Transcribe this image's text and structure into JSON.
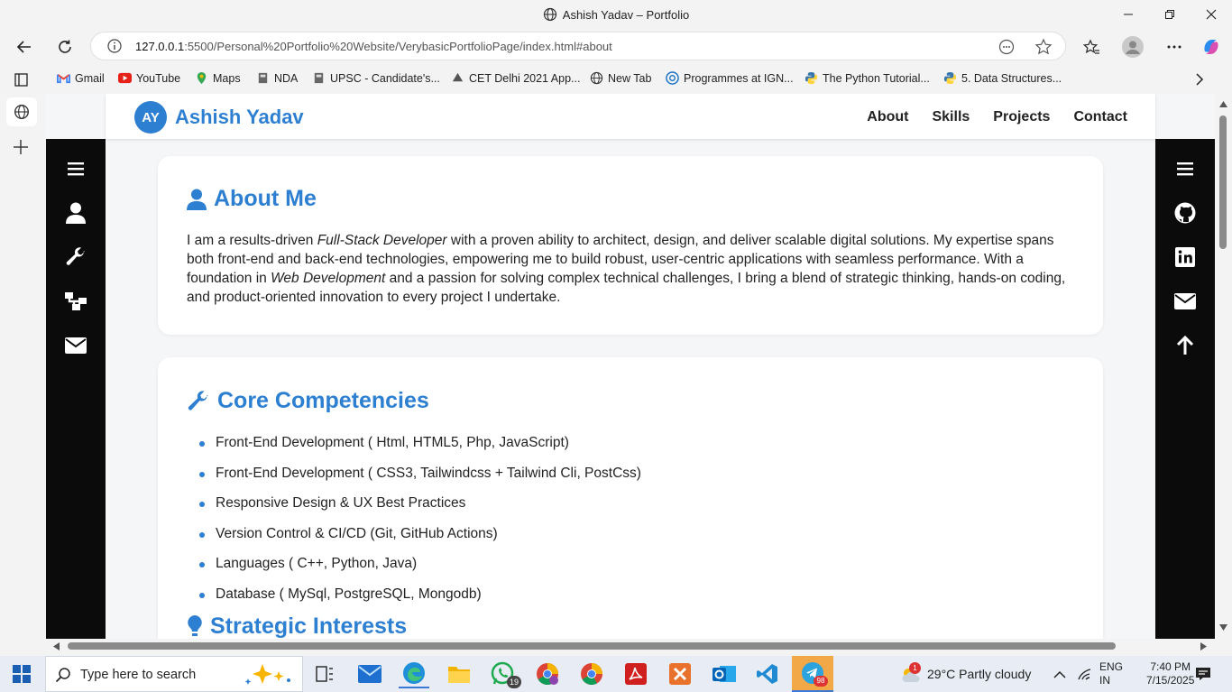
{
  "browser": {
    "window_title": "Ashish Yadav – Portfolio",
    "url_host": "127.0.0.1",
    "url_rest": ":5500/Personal%20Portfolio%20Website/VerybasicPortfolioPage/index.html#about",
    "bookmarks": [
      {
        "label": "Gmail",
        "icon": "gmail-icon"
      },
      {
        "label": "YouTube",
        "icon": "youtube-icon"
      },
      {
        "label": "Maps",
        "icon": "maps-icon"
      },
      {
        "label": "NDA",
        "icon": "emblem-icon"
      },
      {
        "label": "UPSC - Candidate's...",
        "icon": "emblem-icon"
      },
      {
        "label": "CET Delhi 2021 App...",
        "icon": "cet-icon"
      },
      {
        "label": "New Tab",
        "icon": "globe-icon"
      },
      {
        "label": "Programmes at IGN...",
        "icon": "ignou-icon"
      },
      {
        "label": "The Python Tutorial...",
        "icon": "python-icon"
      },
      {
        "label": "5. Data Structures...",
        "icon": "python-icon"
      }
    ]
  },
  "site": {
    "logo_initials": "AY",
    "brand": "Ashish Yadav",
    "menu": [
      "About",
      "Skills",
      "Projects",
      "Contact"
    ],
    "left_nav_icons": [
      "hamburger-icon",
      "user-icon",
      "wrench-icon",
      "sitemap-icon",
      "envelope-icon"
    ],
    "right_nav_icons": [
      "hamburger-icon",
      "github-icon",
      "linkedin-icon",
      "envelope-icon",
      "arrow-up-icon"
    ],
    "accent": "#2d7fd1"
  },
  "about": {
    "heading": "About Me",
    "p1": "I am a results-driven ",
    "em1": "Full-Stack Developer",
    "p2": " with a proven ability to architect, design, and deliver scalable digital solutions. My expertise spans both front-end and back-end technologies, empowering me to build robust, user-centric applications with seamless performance. With a foundation in ",
    "em2": "Web Development",
    "p3": " and a passion for solving complex technical challenges, I bring a blend of strategic thinking, hands-on coding, and product-oriented innovation to every project I undertake."
  },
  "competencies": {
    "heading": "Core Competencies",
    "items": [
      "Front-End Development ( Html, HTML5, Php, JavaScript)",
      "Front-End Development ( CSS3, Tailwindcss + Tailwind Cli, PostCss)",
      "Responsive Design & UX Best Practices",
      "Version Control & CI/CD (Git, GitHub Actions)",
      "Languages ( C++, Python, Java)",
      "Database ( MySql, PostgreSQL, Mongodb)"
    ],
    "next_heading": "Strategic Interests"
  },
  "taskbar": {
    "search_placeholder": "Type here to search",
    "whatsapp_badge": "19",
    "telegram_badge": "98",
    "weather_badge": "1",
    "weather": "29°C  Partly cloudy",
    "lang1": "ENG",
    "lang2": "IN",
    "time": "7:40 PM",
    "date": "7/15/2025"
  }
}
